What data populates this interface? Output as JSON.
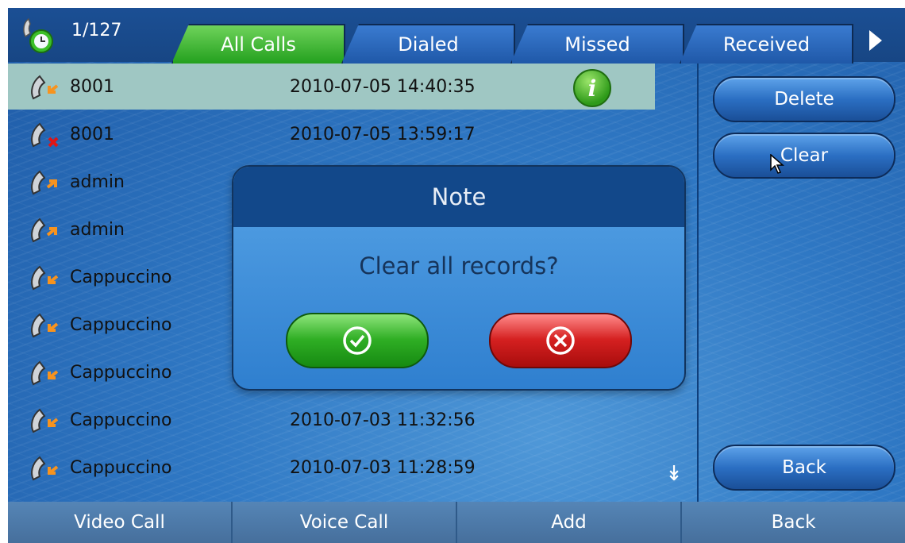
{
  "header": {
    "counter": "1/127",
    "tabs": [
      {
        "label": "All Calls",
        "active": true
      },
      {
        "label": "Dialed",
        "active": false
      },
      {
        "label": "Missed",
        "active": false
      },
      {
        "label": "Received",
        "active": false
      }
    ]
  },
  "calls": [
    {
      "name": "8001",
      "time": "2010-07-05 14:40:35",
      "type": "received",
      "selected": true
    },
    {
      "name": "8001",
      "time": "2010-07-05 13:59:17",
      "type": "missed"
    },
    {
      "name": "admin",
      "time": "",
      "type": "dialed"
    },
    {
      "name": "admin",
      "time": "",
      "type": "dialed"
    },
    {
      "name": "Cappuccino",
      "time": "",
      "type": "received"
    },
    {
      "name": "Cappuccino",
      "time": "",
      "type": "received"
    },
    {
      "name": "Cappuccino",
      "time": "",
      "type": "received"
    },
    {
      "name": "Cappuccino",
      "time": "2010-07-03 11:32:56",
      "type": "received"
    },
    {
      "name": "Cappuccino",
      "time": "2010-07-03 11:28:59",
      "type": "received"
    }
  ],
  "side_buttons": {
    "delete": "Delete",
    "clear": "Clear",
    "back": "Back"
  },
  "dialog": {
    "title": "Note",
    "message": "Clear all records?"
  },
  "bottom_bar": [
    "Video Call",
    "Voice Call",
    "Add",
    "Back"
  ],
  "colors": {
    "active_tab": "#23a01e",
    "ok": "#2fae24",
    "cancel": "#d52020",
    "selected_row": "#9fc7c3"
  }
}
